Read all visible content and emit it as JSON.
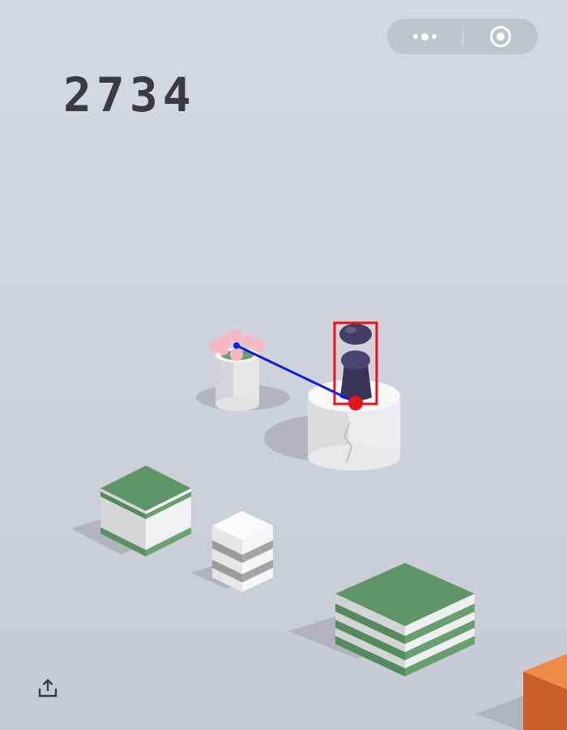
{
  "game": {
    "score": "2734"
  },
  "capsule": {
    "more_icon": "more-dots-icon",
    "close_icon": "mini-program-close-icon"
  },
  "share": {
    "icon": "share-upload-icon"
  },
  "colors": {
    "background": "#d3d5de",
    "score": "#3b3b3f",
    "green_top": "#5f9667",
    "piece": "#3a3358",
    "orange": "#e9793a",
    "target_box": "#e4141c",
    "trajectory": "#0b1de0"
  }
}
